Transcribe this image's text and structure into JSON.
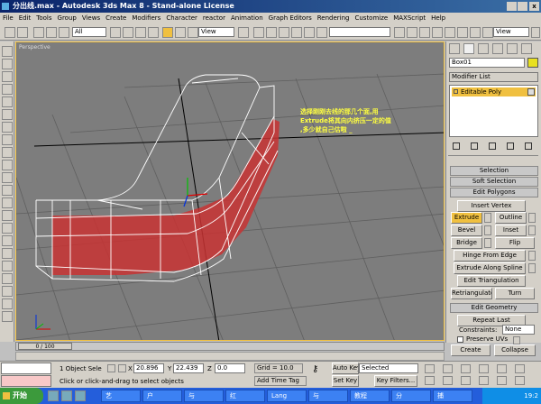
{
  "titlebar": {
    "title": "分出线.max - Autodesk 3ds Max 8 - Stand-alone License",
    "bg": "#0a246a"
  },
  "menu": [
    "File",
    "Edit",
    "Tools",
    "Group",
    "Views",
    "Create",
    "Modifiers",
    "Character",
    "reactor",
    "Animation",
    "Graph Editors",
    "Rendering",
    "Customize",
    "MAXScript",
    "Help"
  ],
  "toolbar": {
    "selection_filter": "All",
    "ref_coord": "View",
    "ref_coord2": "View"
  },
  "viewport": {
    "label": "Perspective",
    "annotation": "选择刚刚去线的那几个面,用\nExtrude将其向内挤压一定的值\n,多少就自己估啦 _"
  },
  "panel": {
    "object_name": "Box01",
    "modifier_list": "Modifier List",
    "stack_item": "Editable Poly",
    "rollouts": {
      "selection": "Selection",
      "soft_selection": "Soft Selection",
      "edit_polygons": "Edit Polygons",
      "edit_geometry": "Edit Geometry"
    },
    "edit_polygons": {
      "insert_vertex": "Insert Vertex",
      "extrude": "Extrude",
      "outline": "Outline",
      "bevel": "Bevel",
      "inset": "Inset",
      "bridge": "Bridge",
      "flip": "Flip",
      "hinge": "Hinge From Edge",
      "extrude_spline": "Extrude Along Spline",
      "edit_tri": "Edit Triangulation",
      "retriangulate": "Retriangulate",
      "turn": "Turn"
    },
    "edit_geometry": {
      "repeat_last": "Repeat Last",
      "constraints_label": "Constraints:",
      "constraints_value": "None",
      "preserve_uvs": "Preserve UVs",
      "create": "Create",
      "collapse": "Collapse"
    }
  },
  "timeline": {
    "frame": "0 / 100"
  },
  "status": {
    "selection": "1 Object Sele",
    "x_label": "X",
    "x": "20.896",
    "y_label": "Y",
    "y": "22.439",
    "z_label": "Z",
    "z": "0.0",
    "grid": "Grid = 10.0",
    "autokey": "Auto Key",
    "autokey_value": "Selected",
    "setkey": "Set Key",
    "keyfilters": "Key Filters...",
    "prompt": "Click or click-and-drag to select objects",
    "timetag": "Add Time Tag"
  },
  "taskbar": {
    "start": "开始",
    "items": [
      "艺",
      "户",
      "与",
      "红",
      "Lang",
      "与",
      "教程",
      "分",
      "捕"
    ],
    "clock": "19:2"
  }
}
